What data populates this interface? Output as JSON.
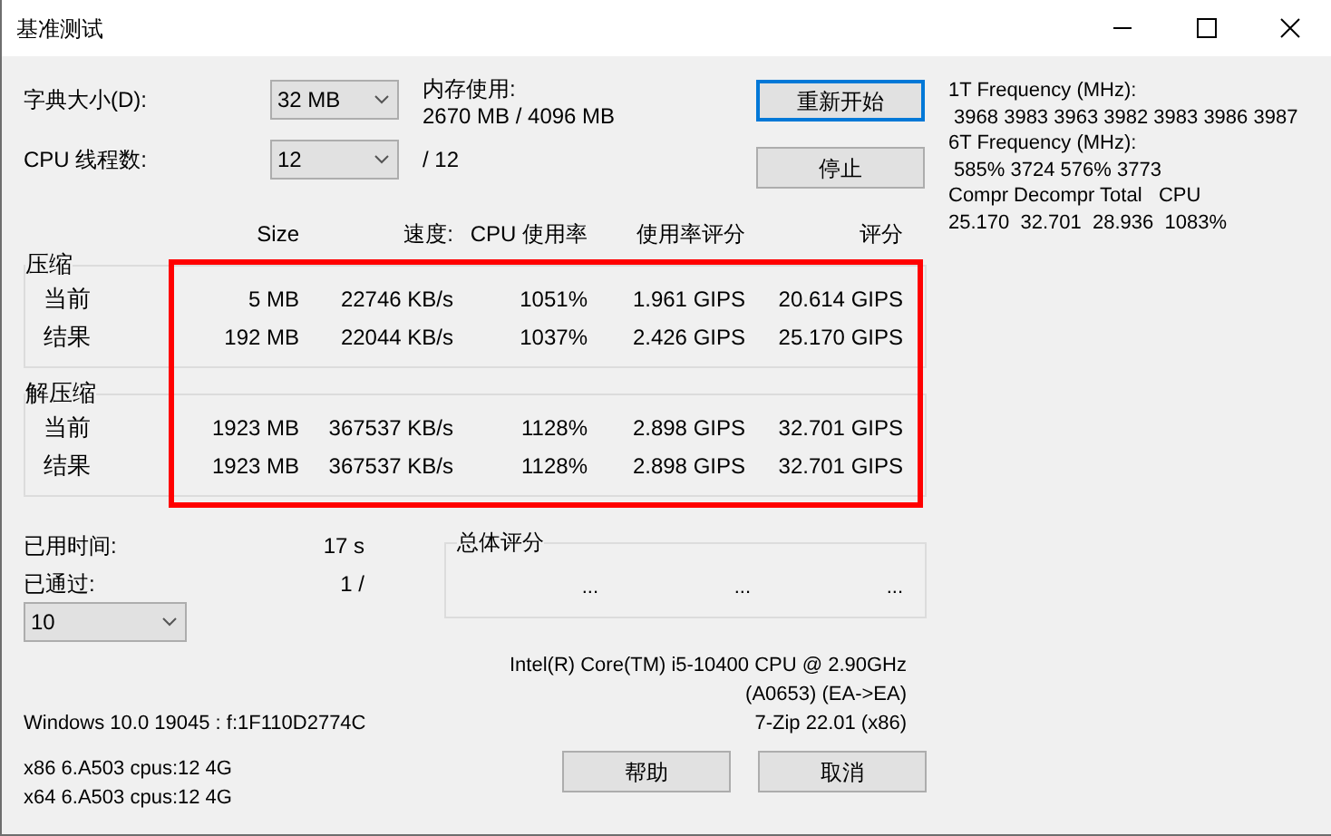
{
  "window": {
    "title": "基准测试"
  },
  "dictionary": {
    "label": "字典大小(D):",
    "value": "32 MB"
  },
  "memory": {
    "label": "内存使用:",
    "value": "2670 MB / 4096 MB"
  },
  "threads": {
    "label": "CPU 线程数:",
    "value": "12",
    "max": "/ 12"
  },
  "buttons": [
    {
      "label": "重新开始",
      "focused": true
    },
    {
      "label": "停止",
      "focused": false
    }
  ],
  "frequency_info": [
    "1T Frequency (MHz):",
    " 3968 3983 3963 3982 3983 3986 3987",
    "6T Frequency (MHz):",
    " 585% 3724 576% 3773",
    "Compr Decompr Total   CPU",
    "25.170  32.701  28.936  1083%"
  ],
  "table": {
    "columns": [
      "Size",
      "速度:",
      "CPU 使用率",
      "使用率评分",
      "评分"
    ],
    "groups": [
      {
        "title": "压缩",
        "rows": [
          {
            "label": "当前",
            "cells": [
              "5 MB",
              "22746 KB/s",
              "1051%",
              "1.961 GIPS",
              "20.614 GIPS"
            ]
          },
          {
            "label": "结果",
            "cells": [
              "192 MB",
              "22044 KB/s",
              "1037%",
              "2.426 GIPS",
              "25.170 GIPS"
            ]
          }
        ]
      },
      {
        "title": "解压缩",
        "rows": [
          {
            "label": "当前",
            "cells": [
              "1923 MB",
              "367537 KB/s",
              "1128%",
              "2.898 GIPS",
              "32.701 GIPS"
            ]
          },
          {
            "label": "结果",
            "cells": [
              "1923 MB",
              "367537 KB/s",
              "1128%",
              "2.898 GIPS",
              "32.701 GIPS"
            ]
          }
        ]
      }
    ]
  },
  "annotation": {
    "kind": "frame"
  },
  "elapsed": {
    "label": "已用时间:",
    "value": "17 s"
  },
  "passes": {
    "label": "已通过:",
    "value": "1 /",
    "select_value": "10"
  },
  "total_rating": {
    "title": "总体评分",
    "values": [
      "...",
      "...",
      "..."
    ]
  },
  "cpu_info": [
    "Intel(R) Core(TM) i5-10400 CPU @ 2.90GHz",
    "(A0653) (EA->EA)",
    "7-Zip 22.01 (x86)"
  ],
  "os_info": "Windows 10.0 19045 :  f:1F110D2774C",
  "arch_info": [
    "x86 6.A503 cpus:12 4G",
    "x64 6.A503 cpus:12 4G"
  ],
  "footer_buttons": [
    "帮助",
    "取消"
  ]
}
